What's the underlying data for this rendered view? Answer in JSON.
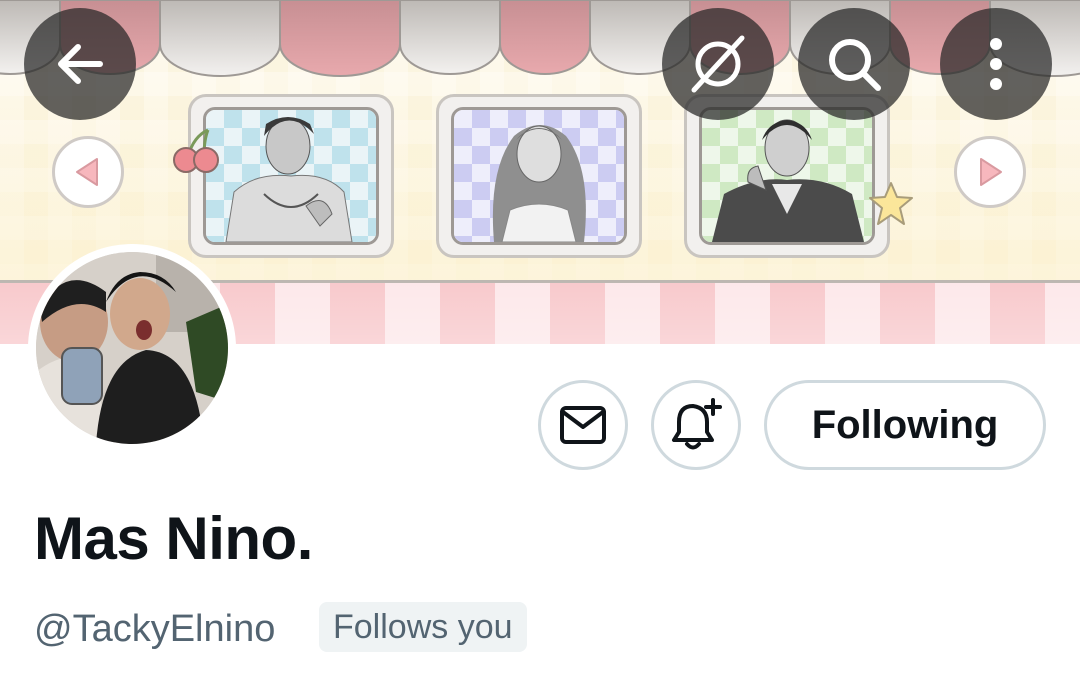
{
  "header": {
    "back_icon": "arrow-left-icon",
    "actions": [
      {
        "name": "grok-icon"
      },
      {
        "name": "search-icon"
      },
      {
        "name": "more-vertical-icon"
      }
    ]
  },
  "banner": {
    "prev_icon": "triangle-left-icon",
    "next_icon": "triangle-right-icon",
    "colors": {
      "awning_pink": "#e8a9ad",
      "awning_white": "#f3f1ef",
      "stripe_pink": "#f8c9cc",
      "triangle_pink": "#f7b7bd"
    }
  },
  "profile": {
    "display_name": "Mas Nino.",
    "handle": "@TackyElnino",
    "follows_you": "Follows you",
    "follow_button": "Following",
    "message_icon": "envelope-icon",
    "notify_icon": "bell-plus-icon"
  }
}
